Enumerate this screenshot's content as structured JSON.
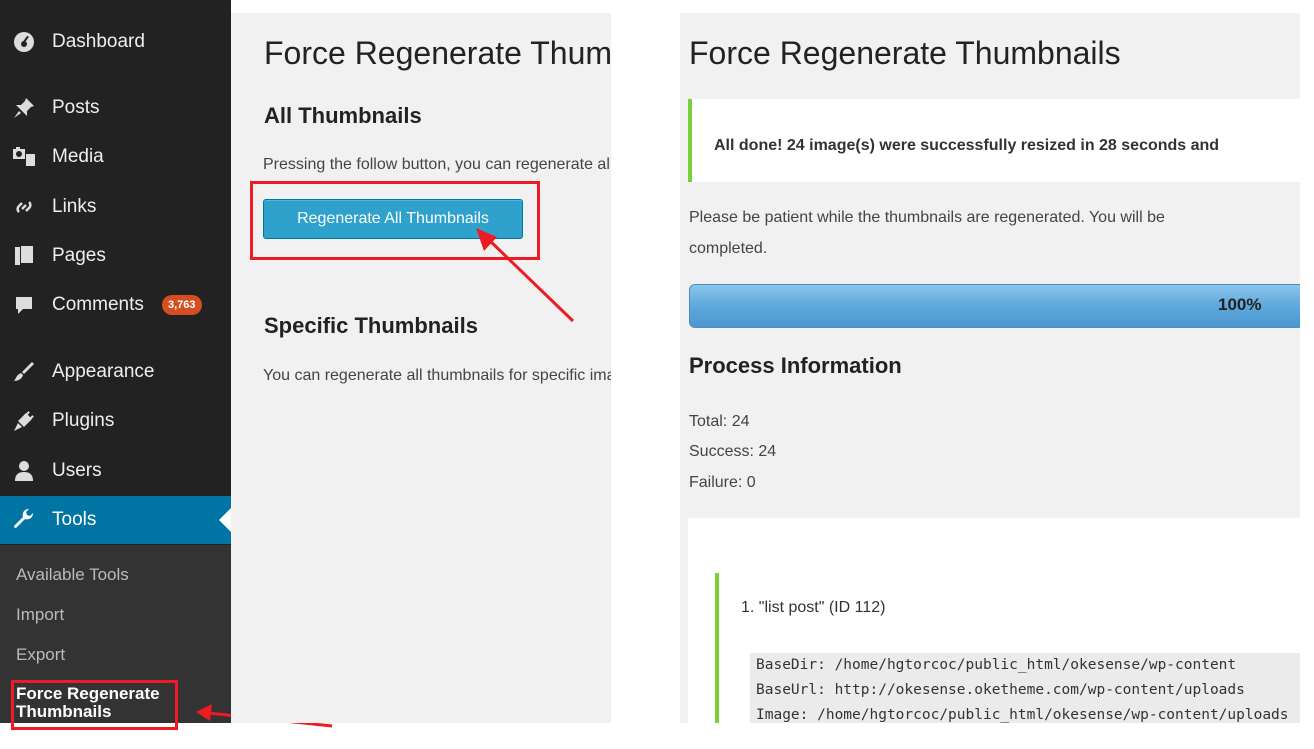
{
  "sidebar": {
    "items": [
      {
        "label": "Dashboard",
        "icon": "dashboard-icon"
      },
      {
        "label": "Posts",
        "icon": "pin-icon"
      },
      {
        "label": "Media",
        "icon": "media-icon"
      },
      {
        "label": "Links",
        "icon": "link-icon"
      },
      {
        "label": "Pages",
        "icon": "pages-icon"
      },
      {
        "label": "Comments",
        "icon": "comment-icon",
        "badge": "3,763"
      },
      {
        "label": "Appearance",
        "icon": "brush-icon"
      },
      {
        "label": "Plugins",
        "icon": "plugin-icon"
      },
      {
        "label": "Users",
        "icon": "users-icon"
      },
      {
        "label": "Tools",
        "icon": "wrench-icon",
        "active": true
      }
    ],
    "submenu": [
      "Available Tools",
      "Import",
      "Export",
      "Force Regenerate Thumbnails"
    ]
  },
  "left": {
    "title": "Force Regenerate Thumbnails",
    "all_heading": "All Thumbnails",
    "all_desc": "Pressing the follow button, you can regenerate all thumbnails",
    "button": "Regenerate All Thumbnails",
    "specific_heading": "Specific Thumbnails",
    "specific_desc": "You can regenerate all thumbnails for specific images"
  },
  "right": {
    "title": "Force Regenerate Thumbnails",
    "notice": "All done! 24 image(s) were successfully resized in 28 seconds and",
    "patience": "Please be patient while the thumbnails are regenerated. You will be",
    "patience2": "completed.",
    "progress_label": "100%",
    "progress_value": 1.0,
    "process_heading": "Process Information",
    "total": "Total: 24",
    "success": "Success: 24",
    "failure": "Failure: 0",
    "log_title": "1. \"list post\" (ID 112)",
    "log_lines": [
      "BaseDir: /home/hgtorcoc/public_html/okesense/wp-content",
      "BaseUrl: http://okesense.oketheme.com/wp-content/uploads",
      "Image: /home/hgtorcoc/public_html/okesense/wp-content/uploads"
    ]
  },
  "colors": {
    "accent": "#0074a2",
    "annotation": "#ee1b24",
    "success": "#7ad03a",
    "badge": "#d54e21"
  }
}
